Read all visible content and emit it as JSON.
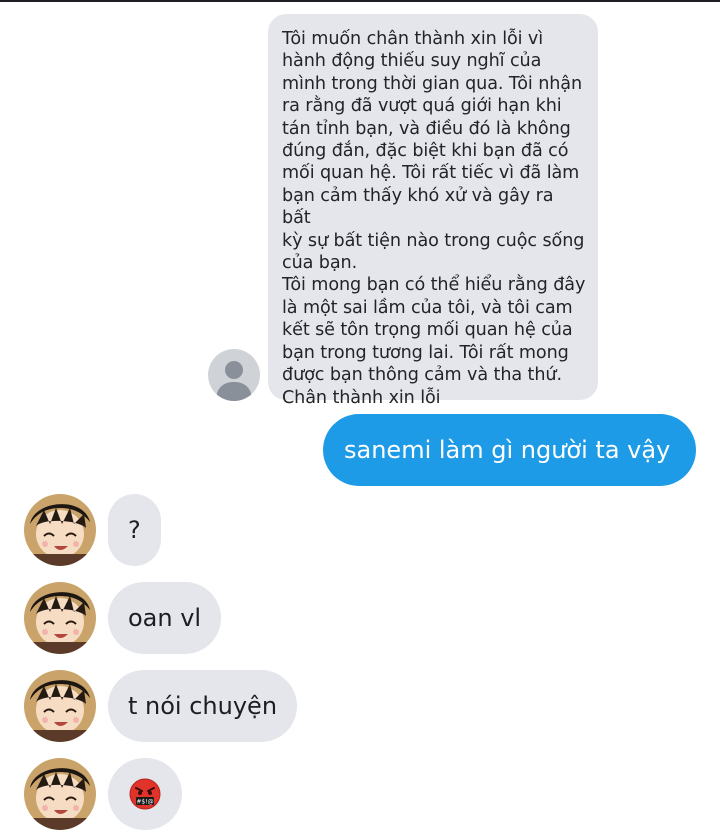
{
  "conversation": {
    "quoted_message": "Tôi muốn chân thành xin lỗi vì\nhành động thiếu suy nghĩ của\nmình trong thời gian qua. Tôi nhận\nra rằng đã vượt quá giới hạn khi\ntán tỉnh bạn, và điều đó là không\nđúng đắn, đặc biệt khi bạn đã có\nmối quan hệ. Tôi rất tiếc vì đã làm\nbạn cảm thấy khó xử và gây ra bất\nkỳ sự bất tiện nào trong cuộc sống\ncủa bạn.\nTôi mong bạn có thể hiểu rằng đây\nlà một sai lầm của tôi, và tôi cam\nkết sẽ tôn trọng mối quan hệ của\nbạn trong tương lai. Tôi rất mong\nđược bạn thông cảm và tha thứ.\nChân thành xin lỗi",
    "sent_message": "sanemi làm gì người ta vậy",
    "received_messages": [
      {
        "text": "?"
      },
      {
        "text": "oan vl"
      },
      {
        "text": "t nói chuyện"
      },
      {
        "emoji": "🤬",
        "icon": "cursing-face-emoji"
      }
    ]
  },
  "colors": {
    "sent_bubble": "#1e9be6",
    "received_bubble": "#e4e6eb",
    "text_dark": "#1c1e21",
    "text_light": "#ffffff"
  },
  "icons": {
    "quoted_sender_avatar": "default-user-icon",
    "contact_avatar": "anime-character-avatar"
  }
}
